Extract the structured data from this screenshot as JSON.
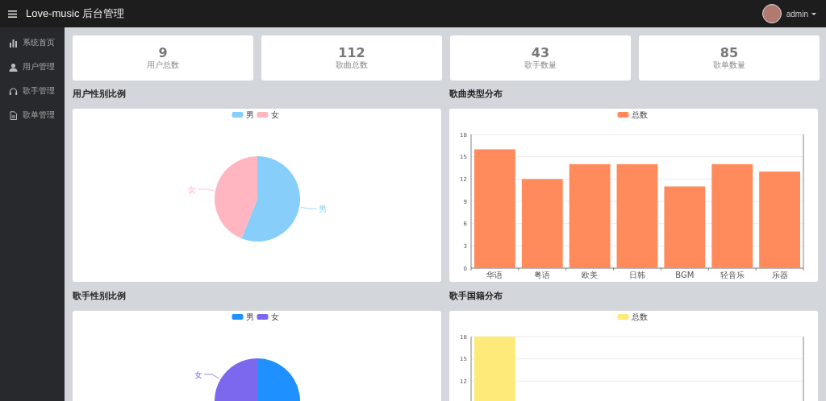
{
  "header": {
    "title": "Love-music 后台管理",
    "user": "admin"
  },
  "sidebar": {
    "items": [
      {
        "label": "系统首页"
      },
      {
        "label": "用户管理"
      },
      {
        "label": "歌手管理"
      },
      {
        "label": "歌单管理"
      }
    ]
  },
  "stats": [
    {
      "value": "9",
      "label": "用户总数"
    },
    {
      "value": "112",
      "label": "歌曲总数"
    },
    {
      "value": "43",
      "label": "歌手数量"
    },
    {
      "value": "85",
      "label": "歌单数量"
    }
  ],
  "panels": [
    {
      "title": "用户性别比例",
      "chart_data": {
        "type": "pie",
        "categories": [
          "男",
          "女"
        ],
        "series": [
          {
            "values": [
              56,
              44
            ]
          }
        ],
        "colors": [
          "#87cefa",
          "#ffb6c1"
        ],
        "legend": true
      }
    },
    {
      "title": "歌曲类型分布",
      "chart_data": {
        "type": "bar",
        "categories": [
          "华语",
          "粤语",
          "欧美",
          "日韩",
          "BGM",
          "轻音乐",
          "乐器"
        ],
        "series": [
          {
            "name": "总数",
            "color": "#ff8a5c",
            "values": [
              16,
              12,
              14,
              14,
              11,
              14,
              13
            ]
          }
        ],
        "ylim": [
          0,
          18
        ],
        "yticks": [
          0,
          3,
          6,
          9,
          12,
          15,
          18
        ],
        "legend": true,
        "grid": true
      }
    },
    {
      "title": "歌手性别比例",
      "chart_data": {
        "type": "pie",
        "categories": [
          "男",
          "女"
        ],
        "series": [
          {
            "values": [
              67,
              33
            ]
          }
        ],
        "colors": [
          "#1e90ff",
          "#7b68ee"
        ],
        "legend": true
      }
    },
    {
      "title": "歌手国籍分布",
      "chart_data": {
        "type": "bar",
        "series": [
          {
            "name": "总数",
            "color": "#fdea78",
            "values": [
              18
            ]
          }
        ],
        "ylim": [
          0,
          18
        ],
        "yticks": [
          12,
          15,
          18
        ],
        "legend": true,
        "grid": true
      }
    }
  ]
}
